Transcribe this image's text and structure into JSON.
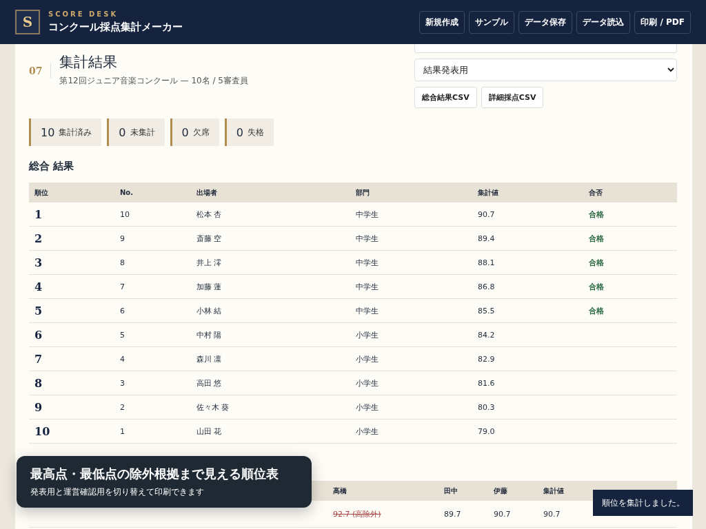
{
  "header": {
    "brand": "SCORE DESK",
    "logo_letter": "S",
    "title": "コンクール採点集計メーカー",
    "buttons": [
      "新規作成",
      "サンプル",
      "データ保存",
      "データ読込",
      "印刷 / PDF"
    ]
  },
  "section": {
    "number": "07",
    "title": "集計結果",
    "subtitle": "第12回ジュニア音楽コンクール — 10名 / 5審査員"
  },
  "controls": {
    "mode_select": "結果発表用",
    "buttons": [
      "総合結果CSV",
      "詳細採点CSV"
    ]
  },
  "stats": [
    {
      "count": "10",
      "label": "集計済み"
    },
    {
      "count": "0",
      "label": "未集計"
    },
    {
      "count": "0",
      "label": "欠席"
    },
    {
      "count": "0",
      "label": "失格"
    }
  ],
  "results": {
    "title": "総合 結果",
    "columns": [
      "順位",
      "No.",
      "出場者",
      "部門",
      "集計値",
      "合否"
    ],
    "rows": [
      {
        "rank": "1",
        "no": "10",
        "name": "松本 杏",
        "division": "中学生",
        "score": "90.7",
        "result": "合格"
      },
      {
        "rank": "2",
        "no": "9",
        "name": "斎藤 空",
        "division": "中学生",
        "score": "89.4",
        "result": "合格"
      },
      {
        "rank": "3",
        "no": "8",
        "name": "井上 澪",
        "division": "中学生",
        "score": "88.1",
        "result": "合格"
      },
      {
        "rank": "4",
        "no": "7",
        "name": "加藤 蓮",
        "division": "中学生",
        "score": "86.8",
        "result": "合格"
      },
      {
        "rank": "5",
        "no": "6",
        "name": "小林 結",
        "division": "中学生",
        "score": "85.5",
        "result": "合格"
      },
      {
        "rank": "6",
        "no": "5",
        "name": "中村 陽",
        "division": "小学生",
        "score": "84.2"
      },
      {
        "rank": "7",
        "no": "4",
        "name": "森川 凛",
        "division": "小学生",
        "score": "82.9"
      },
      {
        "rank": "8",
        "no": "3",
        "name": "高田 悠",
        "division": "小学生",
        "score": "81.6"
      },
      {
        "rank": "9",
        "no": "2",
        "name": "佐々木 葵",
        "division": "小学生",
        "score": "80.3"
      },
      {
        "rank": "10",
        "no": "1",
        "name": "山田 花",
        "division": "小学生",
        "score": "79.0"
      }
    ]
  },
  "detail": {
    "columns": [
      "高橋",
      "田中",
      "伊藤",
      "集計値"
    ],
    "rows": [
      {
        "cells": [
          {
            "text": "92.7 (高除外)",
            "kind": "excluded"
          },
          {
            "text": "89.7",
            "kind": "score"
          },
          {
            "text": "90.7",
            "kind": "score"
          },
          {
            "text": "90.7",
            "kind": "score"
          }
        ]
      }
    ]
  },
  "promo": {
    "title": "最高点・最低点の除外根拠まで見える順位表",
    "subtitle": "発表用と運営確認用を切り替えて印刷できます"
  },
  "toast": {
    "message": "順位を集計しました。"
  }
}
